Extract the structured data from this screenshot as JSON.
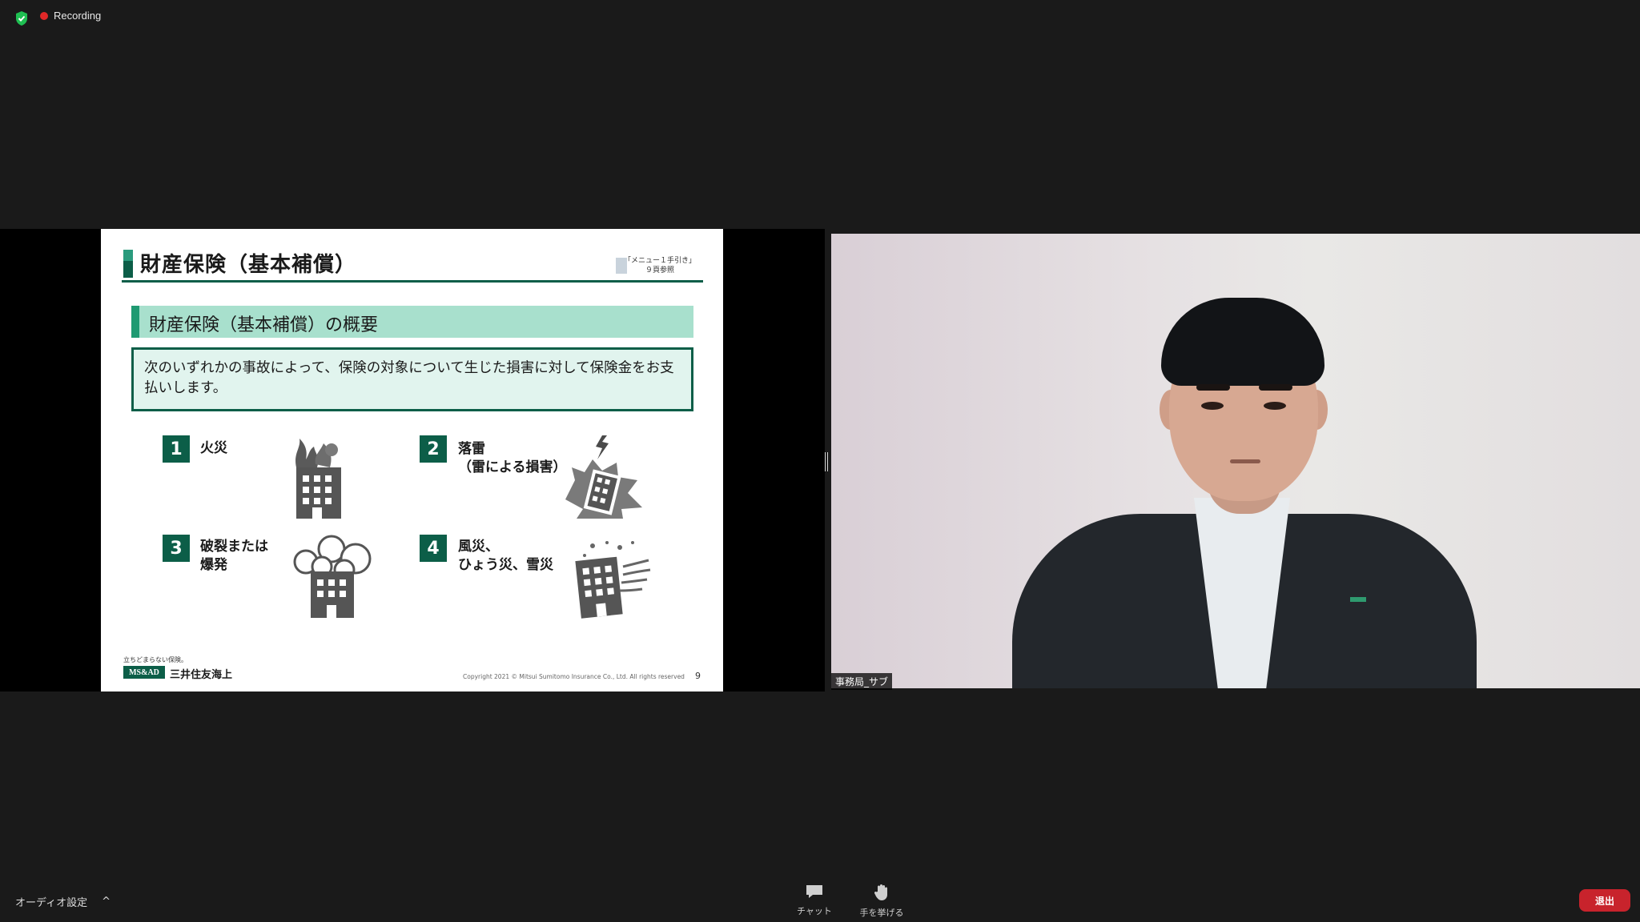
{
  "status": {
    "recording": "Recording",
    "rec_color": "#e02828",
    "shield_color": "#1fbf52"
  },
  "slide": {
    "title": "財産保険（基本補償）",
    "ref_line1": "「メニュー１手引き」",
    "ref_line2": "９頁参照",
    "subhead": "財産保険（基本補償）の概要",
    "description": "次のいずれかの事故によって、保険の対象について生じた損害に対して保険金をお支払いします。",
    "items": [
      {
        "num": "1",
        "label": "火災",
        "icon": "building-fire-icon"
      },
      {
        "num": "2",
        "label_line1": "落雷",
        "label_line2": "（雷による損害）",
        "icon": "building-lightning-icon"
      },
      {
        "num": "3",
        "label_line1": "破裂または",
        "label_line2": "爆発",
        "icon": "building-explosion-icon"
      },
      {
        "num": "4",
        "label_line1": "風災、",
        "label_line2": "ひょう災、雪災",
        "icon": "building-wind-icon"
      }
    ],
    "tagline": "立ちどまらない保険。",
    "logo_mark": "MS&AD",
    "logo_name": "三井住友海上",
    "copyright": "Copyright 2021 © Mitsui Sumitomo Insurance Co., Ltd. All rights reserved",
    "page": "9",
    "accent_dark": "#0c5e48",
    "accent_light": "#a8e0cd"
  },
  "video": {
    "participant_name": "事務局_サブ"
  },
  "toolbar": {
    "audio_settings": "オーディオ設定",
    "audio_chevron": "^",
    "chat": "チャット",
    "raise_hand": "手を挙げる",
    "leave": "退出",
    "leave_color": "#c8232c"
  }
}
